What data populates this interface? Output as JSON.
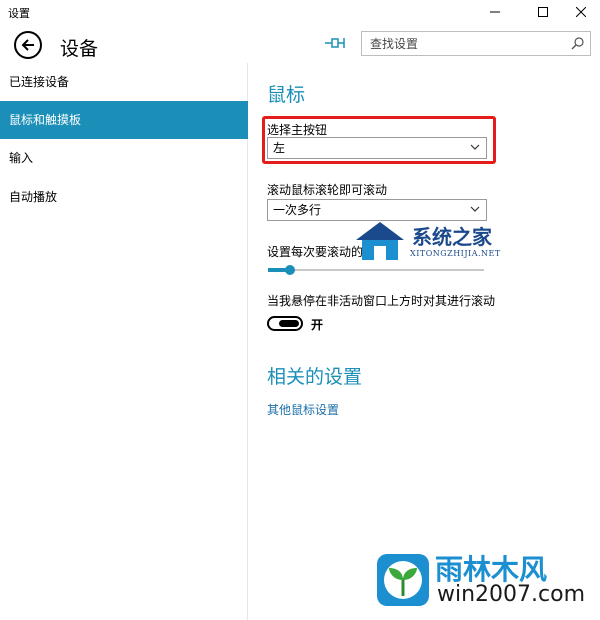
{
  "window": {
    "title": "设置"
  },
  "header": {
    "title": "设备",
    "search_placeholder": "查找设置"
  },
  "sidebar": {
    "items": [
      {
        "label": "已连接设备",
        "active": false
      },
      {
        "label": "鼠标和触摸板",
        "active": true
      },
      {
        "label": "输入",
        "active": false
      },
      {
        "label": "自动播放",
        "active": false
      }
    ]
  },
  "main": {
    "section_title": "鼠标",
    "primary_button": {
      "label": "选择主按钮",
      "value": "左"
    },
    "wheel_scroll": {
      "label": "滚动鼠标滚轮即可滚动",
      "value": "一次多行"
    },
    "lines_per_scroll": {
      "label": "设置每次要滚动的行数",
      "value_fraction": 0.1
    },
    "inactive_scroll": {
      "label": "当我悬停在非活动窗口上方时对其进行滚动",
      "state": "开"
    },
    "related_title": "相关的设置",
    "other_mouse_link": "其他鼠标设置"
  },
  "watermarks": {
    "top": {
      "cn": "系统之家",
      "en": "XITONGZHIJIA.NET"
    },
    "bottom": {
      "cn": "雨林木风",
      "en": "win2007.com"
    }
  },
  "colors": {
    "accent": "#1b8fb8",
    "highlight": "#e51c1c"
  }
}
